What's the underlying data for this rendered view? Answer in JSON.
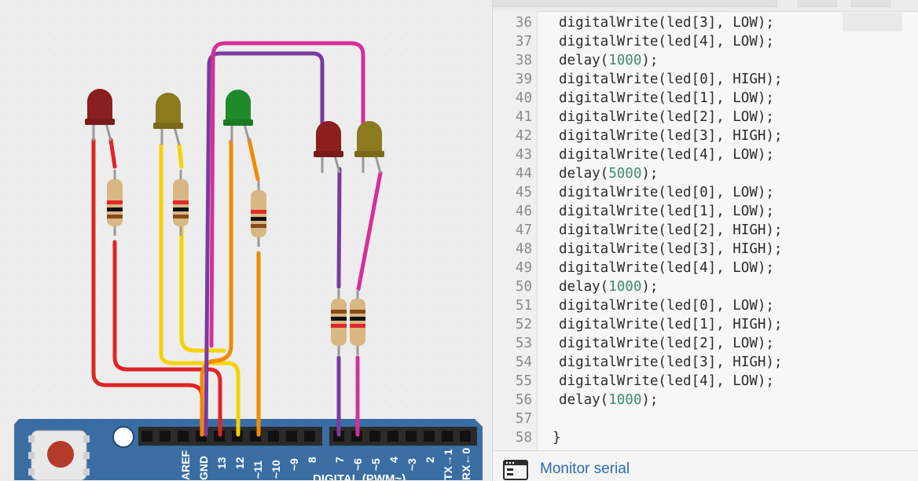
{
  "editor": {
    "lines": [
      {
        "n": "36",
        "pre": "digitalWrite(led[3], LOW);",
        "num": "",
        "post": ""
      },
      {
        "n": "37",
        "pre": "digitalWrite(led[4], LOW);",
        "num": "",
        "post": ""
      },
      {
        "n": "38",
        "pre": "delay(",
        "num": "1000",
        "post": ");"
      },
      {
        "n": "39",
        "pre": "digitalWrite(led[0], HIGH);",
        "num": "",
        "post": ""
      },
      {
        "n": "40",
        "pre": "digitalWrite(led[1], LOW);",
        "num": "",
        "post": ""
      },
      {
        "n": "41",
        "pre": "digitalWrite(led[2], LOW);",
        "num": "",
        "post": ""
      },
      {
        "n": "42",
        "pre": "digitalWrite(led[3], HIGH);",
        "num": "",
        "post": ""
      },
      {
        "n": "43",
        "pre": "digitalWrite(led[4], LOW);",
        "num": "",
        "post": ""
      },
      {
        "n": "44",
        "pre": "delay(",
        "num": "5000",
        "post": ");"
      },
      {
        "n": "45",
        "pre": "digitalWrite(led[0], LOW);",
        "num": "",
        "post": ""
      },
      {
        "n": "46",
        "pre": "digitalWrite(led[1], LOW);",
        "num": "",
        "post": ""
      },
      {
        "n": "47",
        "pre": "digitalWrite(led[2], HIGH);",
        "num": "",
        "post": ""
      },
      {
        "n": "48",
        "pre": "digitalWrite(led[3], HIGH);",
        "num": "",
        "post": ""
      },
      {
        "n": "49",
        "pre": "digitalWrite(led[4], LOW);",
        "num": "",
        "post": ""
      },
      {
        "n": "50",
        "pre": "delay(",
        "num": "1000",
        "post": ");"
      },
      {
        "n": "51",
        "pre": "digitalWrite(led[0], LOW);",
        "num": "",
        "post": ""
      },
      {
        "n": "52",
        "pre": "digitalWrite(led[1], HIGH);",
        "num": "",
        "post": ""
      },
      {
        "n": "53",
        "pre": "digitalWrite(led[2], LOW);",
        "num": "",
        "post": ""
      },
      {
        "n": "54",
        "pre": "digitalWrite(led[3], HIGH);",
        "num": "",
        "post": ""
      },
      {
        "n": "55",
        "pre": "digitalWrite(led[4], LOW);",
        "num": "",
        "post": ""
      },
      {
        "n": "56",
        "pre": "delay(",
        "num": "1000",
        "post": ");"
      },
      {
        "n": "57",
        "pre": "",
        "num": "",
        "post": ""
      },
      {
        "n": "58",
        "pre": "}",
        "num": "",
        "post": ""
      }
    ]
  },
  "monitor": {
    "label": "Monitor serial",
    "icon": "serial-monitor-icon"
  },
  "board": {
    "pin_labels": [
      "AREF",
      "GND",
      "13",
      "12",
      "~11",
      "~10",
      "~9",
      "8",
      "7",
      "~6",
      "~5",
      "4",
      "~3",
      "2",
      "TX→1",
      "RX←0"
    ],
    "digital_label": "DIGITAL (PWM~)",
    "color": "#3a6ea3"
  },
  "leds": [
    {
      "name": "led-red-1",
      "color": "#8b1e1e"
    },
    {
      "name": "led-yellow-1",
      "color": "#8b7a1e"
    },
    {
      "name": "led-green",
      "color": "#1f8a2a"
    },
    {
      "name": "led-red-2",
      "color": "#8b1e1e"
    },
    {
      "name": "led-yellow-2",
      "color": "#8b7a1e"
    }
  ],
  "wire_colors": {
    "red": "#e02424",
    "yellow": "#f5d200",
    "orange": "#f08a00",
    "purple": "#7a3aa0",
    "magenta": "#d62f97"
  }
}
